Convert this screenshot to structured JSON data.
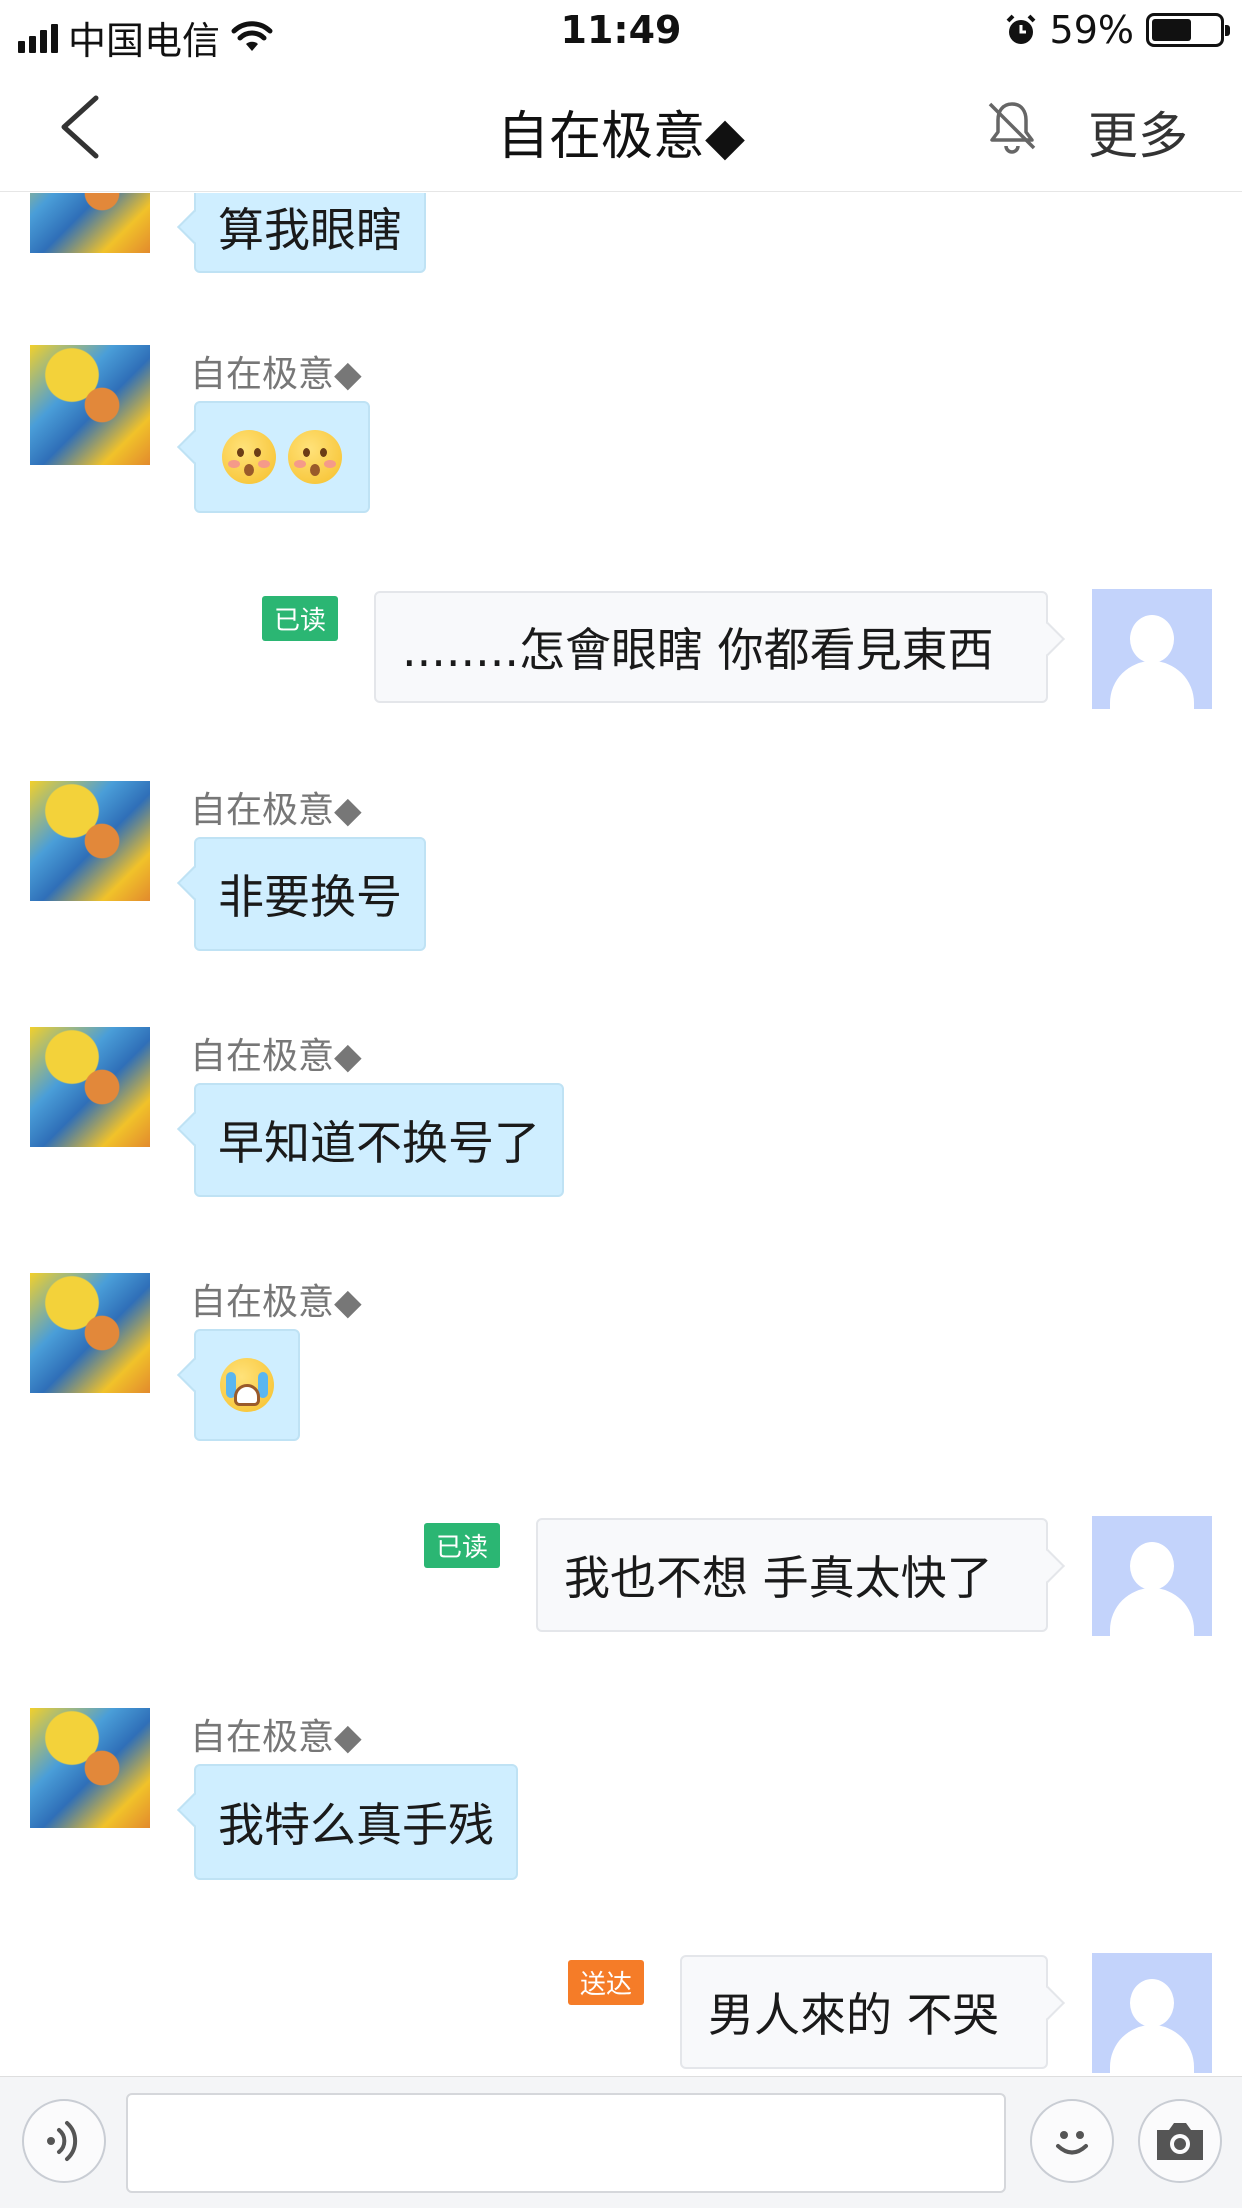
{
  "status_bar": {
    "carrier": "中国电信",
    "time": "11:49",
    "battery_percent": "59%",
    "icons": [
      "signal-icon",
      "wifi-icon",
      "alarm-icon",
      "battery-icon"
    ]
  },
  "nav": {
    "title": "自在极意◆",
    "more_label": "更多",
    "icons": [
      "back-chevron-icon",
      "muted-bell-icon"
    ]
  },
  "messages": [
    {
      "side": "in",
      "sender": "",
      "text": "算我眼瞎"
    },
    {
      "side": "in",
      "sender": "自在极意◆",
      "emoji": [
        "flushed-face",
        "flushed-face"
      ]
    },
    {
      "side": "out",
      "status": "已读",
      "text": "........怎會眼瞎 你都看見東西"
    },
    {
      "side": "in",
      "sender": "自在极意◆",
      "text": "非要换号"
    },
    {
      "side": "in",
      "sender": "自在极意◆",
      "text": "早知道不换号了"
    },
    {
      "side": "in",
      "sender": "自在极意◆",
      "emoji": [
        "crying-face"
      ]
    },
    {
      "side": "out",
      "status": "已读",
      "text": "我也不想 手真太快了"
    },
    {
      "side": "in",
      "sender": "自在极意◆",
      "text": "我特么真手残"
    },
    {
      "side": "out",
      "status": "送达",
      "text": "男人來的 不哭"
    }
  ],
  "input_bar": {
    "text_value": "",
    "icons": [
      "voice-icon",
      "emoji-icon",
      "camera-icon"
    ]
  },
  "colors": {
    "incoming_bubble": "#cfeeff",
    "outgoing_bubble": "#f8f9fb",
    "read_badge": "#2bb673",
    "sent_badge": "#f57c28",
    "self_avatar": "#c3d3fb"
  }
}
